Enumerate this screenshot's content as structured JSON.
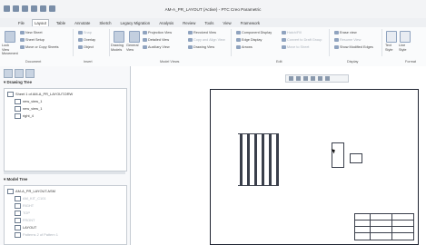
{
  "window": {
    "title": "AM-A_PR_LAYOUT (Active) - PTC Creo Parametric"
  },
  "tabs": [
    "File",
    "Layout",
    "Table",
    "Annotate",
    "Sketch",
    "Legacy Migration",
    "Analysis",
    "Review",
    "Tools",
    "View",
    "Framework"
  ],
  "ribbon": {
    "document": {
      "items": [
        "New Sheet",
        "Sheet Setup",
        "Move or Copy Sheets"
      ],
      "lock_view": "Lock View Movement"
    },
    "insert": {
      "items": [
        "Snap",
        "Overlay",
        "Object"
      ]
    },
    "model_views": {
      "general_view": "General View",
      "drawing_models": "Drawing Models",
      "items": [
        "Projection View",
        "Detailed View",
        "Auxiliary View",
        "Revolved View",
        "Copy and Align View",
        "Drawing View"
      ]
    },
    "edit": {
      "items": [
        "Component Display",
        "Edge Display",
        "Arrows",
        "Hatch/Fill",
        "Convert to Draft Group",
        "Move to Sheet"
      ]
    },
    "display": {
      "items": [
        "Erase view",
        "Resume View",
        "Show Modified Edges"
      ]
    },
    "format": {
      "items": [
        "Text Style",
        "Line Style"
      ]
    }
  },
  "group_labels": [
    "Document",
    "Insert",
    "Model Views",
    "Edit",
    "Display",
    "Format"
  ],
  "drawing_tree": {
    "header": "Drawing Tree",
    "items": [
      "Sheet 1 of AM-A_PR_LAYOUT.DRW",
      "new_view_1",
      "new_view_1",
      "right_4"
    ]
  },
  "model_tree": {
    "header": "Model Tree",
    "items": [
      "AM-A_PR_LAYOUT.ASM",
      "AM_KIT_C101",
      "RIGHT",
      "TOP",
      "FRONT",
      "LAYOUT",
      "Patterns 2 of Pattern 1"
    ]
  }
}
